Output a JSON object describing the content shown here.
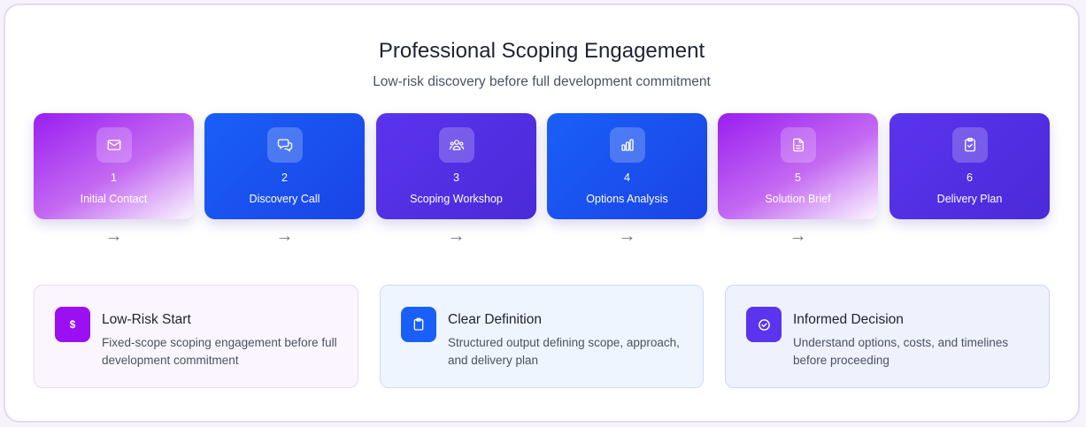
{
  "header": {
    "title": "Professional Scoping Engagement",
    "subtitle": "Low-risk discovery before full development commitment"
  },
  "steps": [
    {
      "number": "1",
      "label": "Initial Contact",
      "icon": "mail-icon"
    },
    {
      "number": "2",
      "label": "Discovery Call",
      "icon": "chat-icon"
    },
    {
      "number": "3",
      "label": "Scoping Workshop",
      "icon": "users-icon"
    },
    {
      "number": "4",
      "label": "Options Analysis",
      "icon": "bar-chart-icon"
    },
    {
      "number": "5",
      "label": "Solution Brief",
      "icon": "document-icon"
    },
    {
      "number": "6",
      "label": "Delivery Plan",
      "icon": "clipboard-check-icon"
    }
  ],
  "arrow_glyph": "→",
  "cards": [
    {
      "title": "Low-Risk Start",
      "description": "Fixed-scope scoping engagement before full development commitment",
      "icon": "dollar-icon",
      "icon_glyph": "$",
      "accent": "#9b10f2"
    },
    {
      "title": "Clear Definition",
      "description": "Structured output defining scope, approach, and delivery plan",
      "icon": "clipboard-icon",
      "accent": "#1a5ff7"
    },
    {
      "title": "Informed Decision",
      "description": "Understand options, costs, and timelines before proceeding",
      "icon": "check-circle-icon",
      "accent": "#5a34ee"
    }
  ],
  "colors": {
    "purple": "#9a1ef0",
    "blue": "#1a5ff7",
    "indigo": "#5a34ee",
    "frame_border": "#e4d8f7"
  }
}
